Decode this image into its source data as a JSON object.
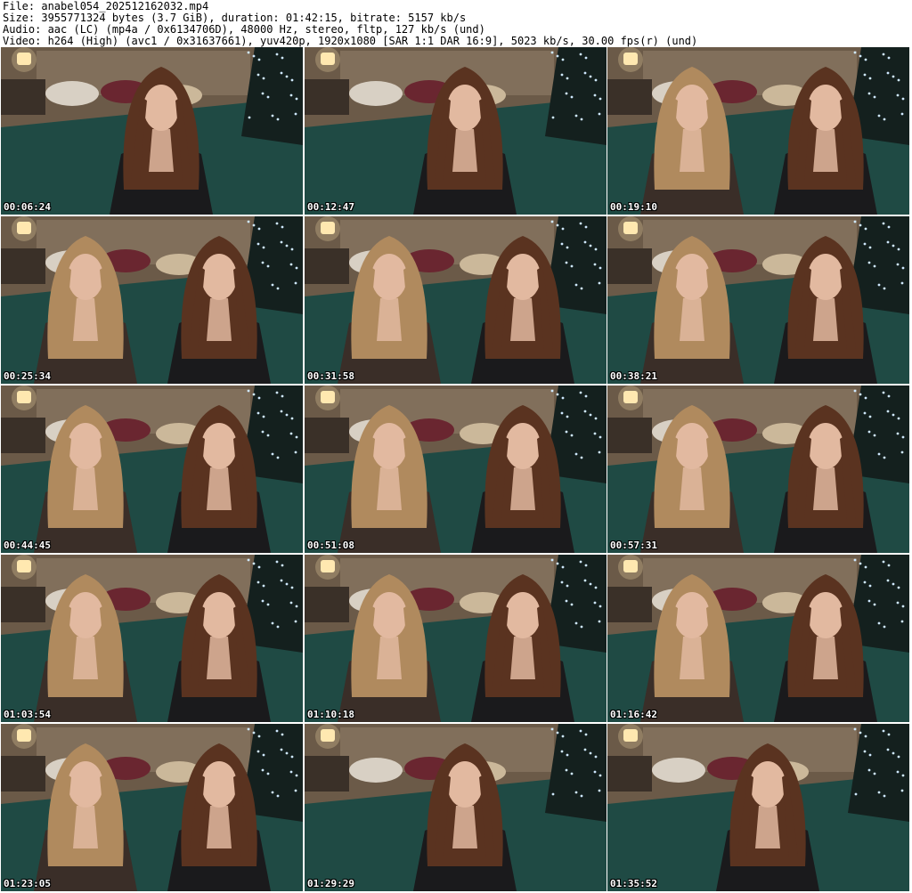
{
  "header": {
    "file_line": "File: anabel054_202512162032.mp4",
    "size_line": "Size: 3955771324 bytes (3.7 GiB), duration: 01:42:15, bitrate: 5157 kb/s",
    "audio_line": "Audio: aac (LC) (mp4a / 0x6134706D), 48000 Hz, stereo, fltp, 127 kb/s (und)",
    "video_line": "Video: h264 (High) (avc1 / 0x31637661), yuv420p, 1920x1080 [SAR 1:1 DAR 16:9], 5023 kb/s, 30.00 fps(r) (und)"
  },
  "thumbnails": [
    {
      "timestamp": "00:06:24",
      "people": 1
    },
    {
      "timestamp": "00:12:47",
      "people": 1
    },
    {
      "timestamp": "00:19:10",
      "people": 2
    },
    {
      "timestamp": "00:25:34",
      "people": 2
    },
    {
      "timestamp": "00:31:58",
      "people": 2
    },
    {
      "timestamp": "00:38:21",
      "people": 2
    },
    {
      "timestamp": "00:44:45",
      "people": 2
    },
    {
      "timestamp": "00:51:08",
      "people": 2
    },
    {
      "timestamp": "00:57:31",
      "people": 2
    },
    {
      "timestamp": "01:03:54",
      "people": 2
    },
    {
      "timestamp": "01:10:18",
      "people": 2
    },
    {
      "timestamp": "01:16:42",
      "people": 2
    },
    {
      "timestamp": "01:23:05",
      "people": 2
    },
    {
      "timestamp": "01:29:29",
      "people": 1
    },
    {
      "timestamp": "01:35:52",
      "people": 1
    }
  ],
  "colors": {
    "bed": "#1f4a44",
    "wall": "#6b5a48",
    "lamp": "#ffe9b0",
    "hair_dark": "#5a3320",
    "hair_light": "#b08a5e",
    "clothing": "#1a1a1c",
    "skin": "#e2b9a0",
    "tree_lights": "#cfe8ff"
  }
}
